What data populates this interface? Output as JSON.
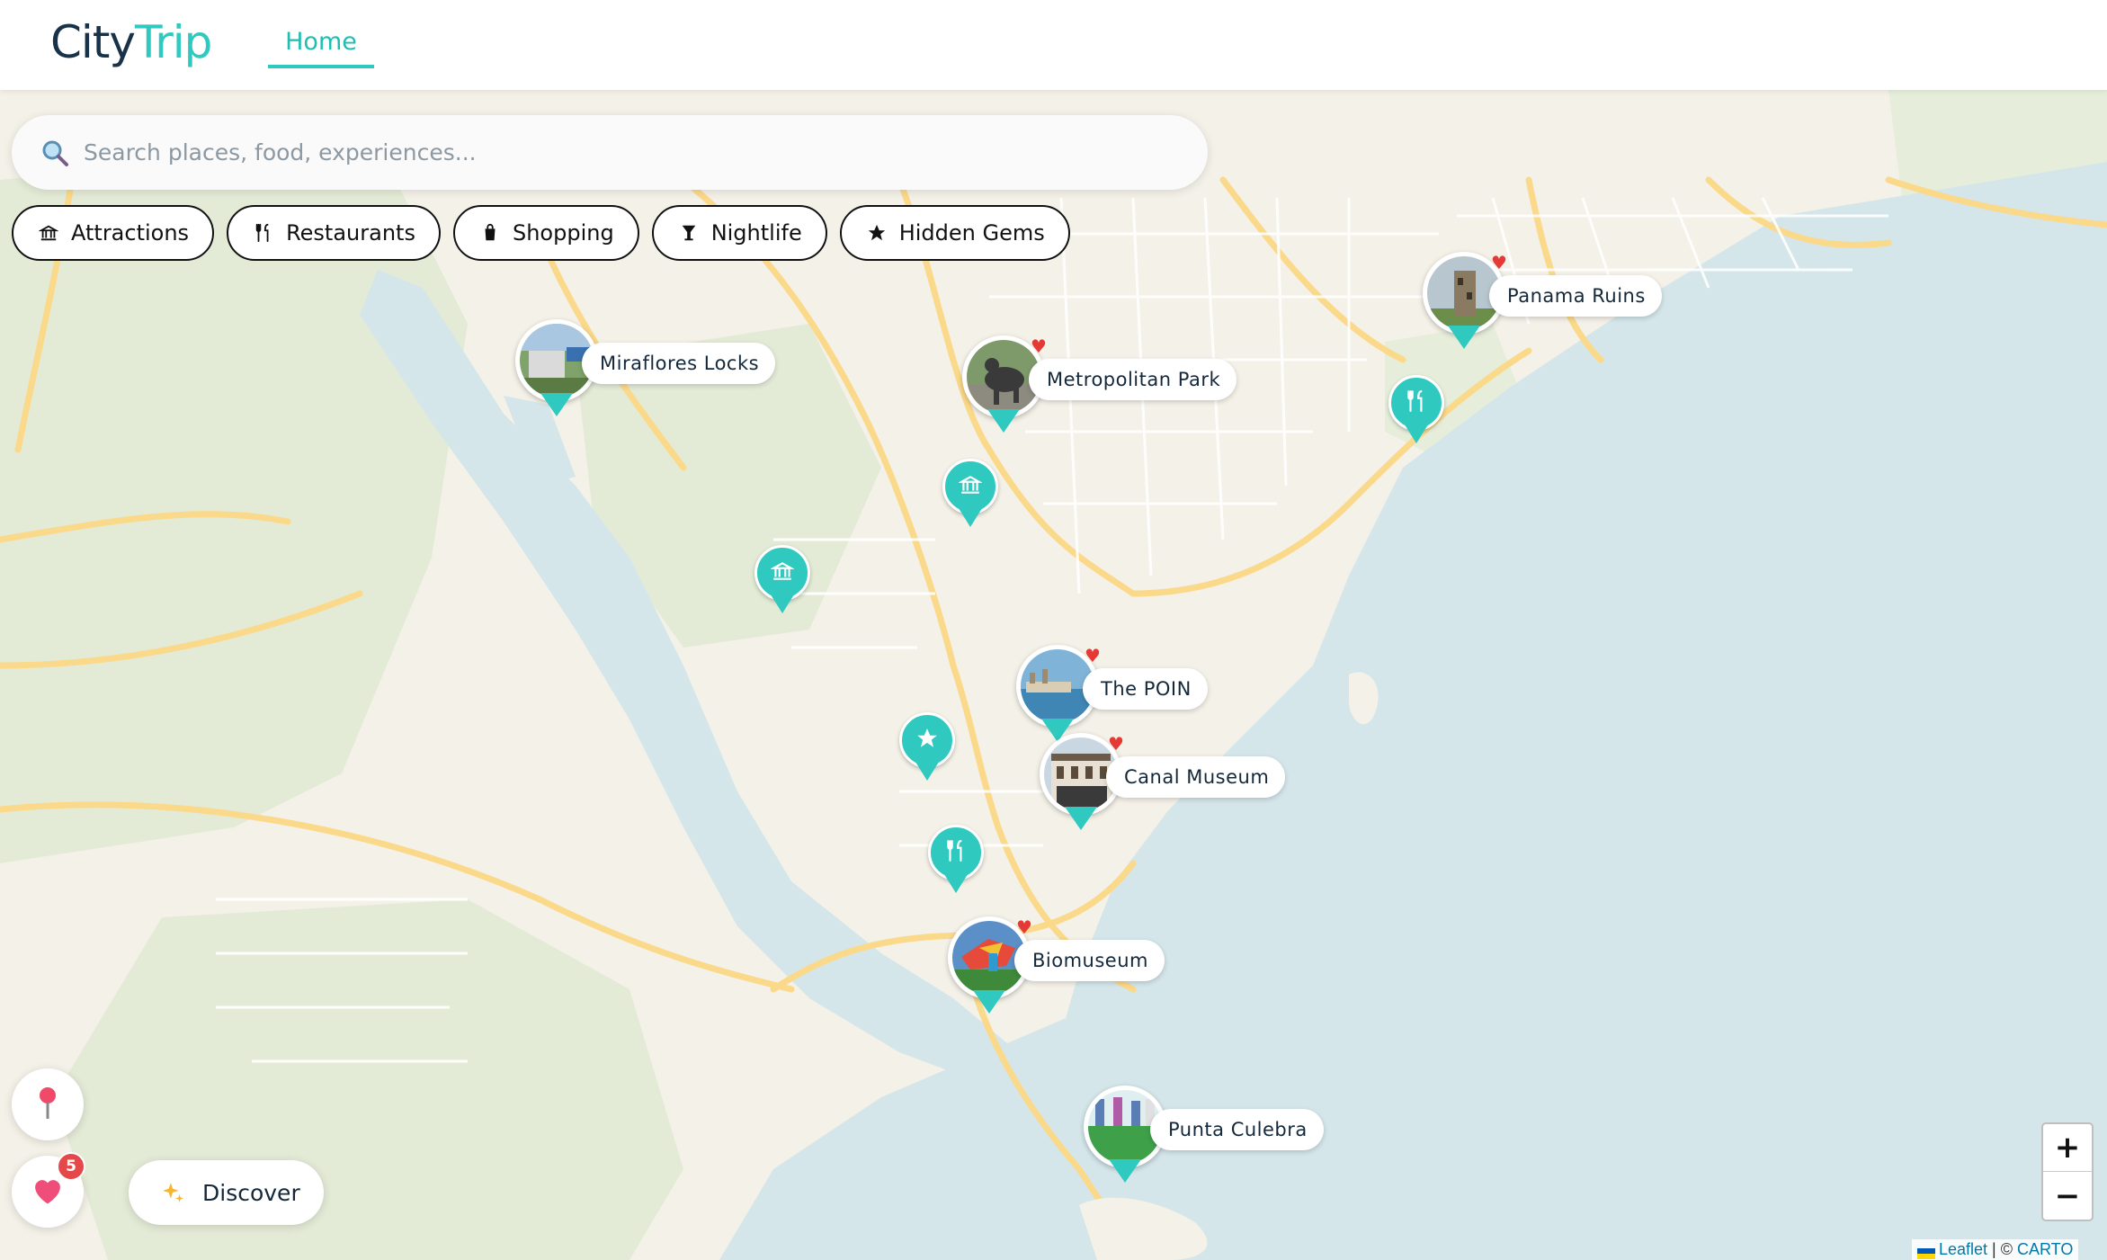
{
  "header": {
    "logo_part1": "City",
    "logo_part2": "Trip",
    "nav_home": "Home"
  },
  "search": {
    "placeholder": "Search places, food, experiences..."
  },
  "filters": [
    {
      "label": "Attractions",
      "icon": "museum-icon"
    },
    {
      "label": "Restaurants",
      "icon": "fork-knife-icon"
    },
    {
      "label": "Shopping",
      "icon": "shopping-bag-icon"
    },
    {
      "label": "Nightlife",
      "icon": "cocktail-icon"
    },
    {
      "label": "Hidden Gems",
      "icon": "star-icon"
    }
  ],
  "places": [
    {
      "name": "Miraflores Locks",
      "favorite": false
    },
    {
      "name": "Metropolitan Park",
      "favorite": true
    },
    {
      "name": "Panama Ruins",
      "favorite": true
    },
    {
      "name": "The POIN",
      "favorite": true
    },
    {
      "name": "Canal Museum",
      "favorite": true
    },
    {
      "name": "Biomuseum",
      "favorite": true
    },
    {
      "name": "Punta Culebra",
      "favorite": false
    }
  ],
  "pins": [
    {
      "type": "restaurant",
      "icon": "fork-knife-icon"
    },
    {
      "type": "attraction",
      "icon": "museum-icon"
    },
    {
      "type": "attraction",
      "icon": "museum-icon"
    },
    {
      "type": "hidden-gem",
      "icon": "star-icon"
    },
    {
      "type": "restaurant",
      "icon": "fork-knife-icon"
    }
  ],
  "controls": {
    "favorites_count": "5",
    "discover_label": "Discover",
    "zoom_in": "+",
    "zoom_out": "−"
  },
  "attribution": {
    "leaflet": "Leaflet",
    "separator": " | © ",
    "carto": "CARTO"
  },
  "colors": {
    "accent": "#2fc9bf",
    "logo_dark": "#18324a",
    "water": "#d4e6ea",
    "land": "#f4f1e8",
    "park": "#e3ebd7",
    "road": "#fbd98a",
    "heart": "#e53935",
    "badge": "#e54848"
  }
}
